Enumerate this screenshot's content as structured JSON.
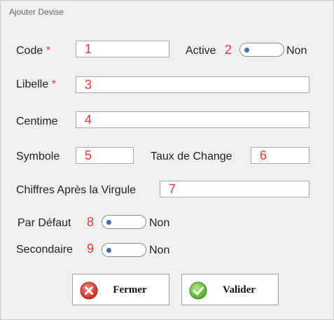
{
  "window": {
    "title": "Ajouter Devise"
  },
  "form": {
    "code": {
      "label": "Code",
      "required_mark": "*",
      "number": "1",
      "value": ""
    },
    "active": {
      "label": "Active",
      "number": "2",
      "state_text": "Non"
    },
    "libelle": {
      "label": "Libelle",
      "required_mark": "*",
      "number": "3",
      "value": ""
    },
    "centime": {
      "label": "Centime",
      "number": "4",
      "value": ""
    },
    "symbole": {
      "label": "Symbole",
      "number": "5",
      "value": ""
    },
    "taux": {
      "label": "Taux de Change",
      "number": "6",
      "value": ""
    },
    "chiffres": {
      "label": "Chiffres Après la Virgule",
      "number": "7",
      "value": ""
    },
    "par_defaut": {
      "label": "Par Défaut",
      "number": "8",
      "state_text": "Non"
    },
    "secondaire": {
      "label": "Secondaire",
      "number": "9",
      "state_text": "Non"
    }
  },
  "buttons": {
    "close": {
      "label": "Fermer",
      "icon": "close-circle-icon"
    },
    "validate": {
      "label": "Valider",
      "icon": "check-circle-icon"
    }
  },
  "colors": {
    "required": "#e53935",
    "number": "#e53935",
    "toggle_knob": "#4c6aa6",
    "close_icon": "#d9302c",
    "check_icon": "#5cb531"
  }
}
